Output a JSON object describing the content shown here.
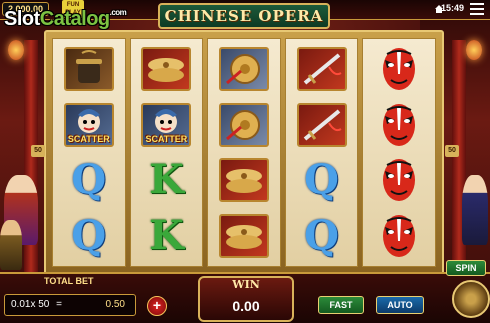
{
  "top": {
    "balance": "2,000.00",
    "funplay_badge": "FUN PLAY",
    "watermark_left": "Slot",
    "watermark_right": "Catalog",
    "watermark_sup": ".com",
    "game_title": "CHINESE OPERA",
    "clock": "15:49"
  },
  "reels": [
    [
      "cauldron",
      "scatter",
      "Q",
      "Q"
    ],
    [
      "cymbals",
      "scatter",
      "K",
      "K"
    ],
    [
      "gong",
      "gong",
      "cymbals",
      "cymbals"
    ],
    [
      "sword",
      "sword",
      "Q",
      "Q"
    ],
    [
      "opera-mask",
      "opera-mask",
      "opera-mask",
      "opera-mask"
    ]
  ],
  "symbol_text": {
    "scatter": "SCATTER",
    "Q": "Q",
    "K": "K"
  },
  "paylines_marker": "50",
  "bottom": {
    "total_bet_label": "TOTAL BET",
    "bet_value": "0.01x",
    "lines": "50",
    "equals": "=",
    "total_bet": "0.50",
    "plus_symbol": "+",
    "win_label": "WIN",
    "win_value": "0.00",
    "fast_label": "FAST",
    "auto_label": "AUTO",
    "spin_label": "SPIN"
  },
  "colors": {
    "gold": "#d8b25a",
    "title_green": "#1c5a3a",
    "q_blue": "#4aa0e8",
    "k_green": "#3aa83a",
    "mask_red": "#d8281a"
  }
}
